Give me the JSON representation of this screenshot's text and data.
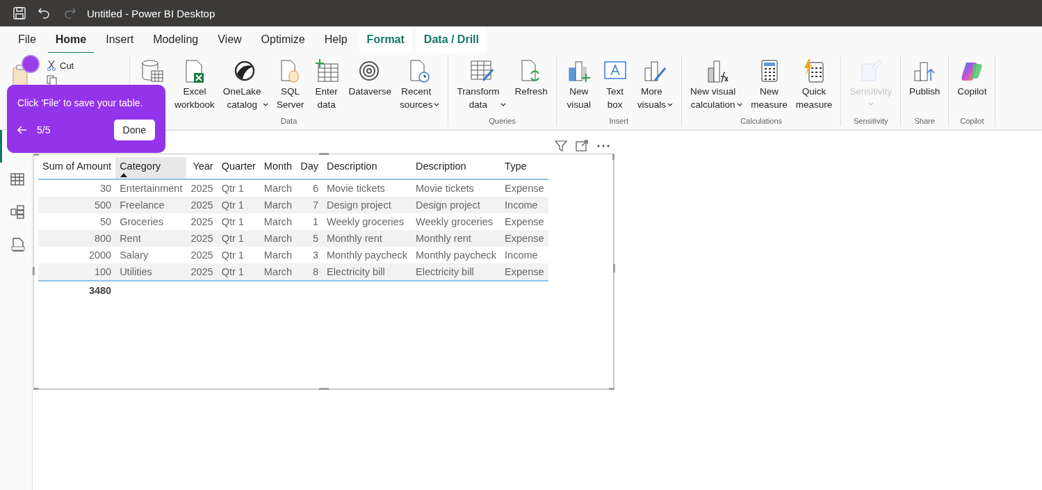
{
  "window": {
    "title": "Untitled - Power BI Desktop"
  },
  "quick_access": [
    {
      "disabled": false
    },
    {
      "disabled": false
    },
    {
      "disabled": true
    }
  ],
  "menu_tabs": [
    {
      "label": "File",
      "selected": false,
      "kind": "normal"
    },
    {
      "label": "Home",
      "selected": true,
      "kind": "normal"
    },
    {
      "label": "Insert",
      "selected": false,
      "kind": "normal"
    },
    {
      "label": "Modeling",
      "selected": false,
      "kind": "normal"
    },
    {
      "label": "View",
      "selected": false,
      "kind": "normal"
    },
    {
      "label": "Optimize",
      "selected": false,
      "kind": "normal"
    },
    {
      "label": "Help",
      "selected": false,
      "kind": "normal"
    },
    {
      "label": "Format",
      "selected": false,
      "kind": "contextual"
    },
    {
      "label": "Data / Drill",
      "selected": false,
      "kind": "contextual"
    }
  ],
  "clipboard": {
    "cut_label": "Cut"
  },
  "ribbon_groups": [
    {
      "label": "Data",
      "buttons": [
        {
          "dropdown": false,
          "disabled": false
        },
        {
          "label": "Excel\nworkbook",
          "dropdown": false,
          "disabled": false
        },
        {
          "label": "OneLake\ncatalog",
          "dropdown": true,
          "disabled": false
        },
        {
          "label": "SQL\nServer",
          "dropdown": false,
          "disabled": false
        },
        {
          "label": "Enter\ndata",
          "dropdown": false,
          "disabled": false
        },
        {
          "label": "Dataverse",
          "dropdown": false,
          "disabled": false
        },
        {
          "label": "Recent\nsources",
          "dropdown": true,
          "disabled": false
        }
      ]
    },
    {
      "label": "Queries",
      "buttons": [
        {
          "label": "Transform\ndata",
          "dropdown": true,
          "disabled": false
        },
        {
          "label": "Refresh",
          "dropdown": false,
          "disabled": false
        }
      ]
    },
    {
      "label": "Insert",
      "buttons": [
        {
          "label": "New\nvisual",
          "dropdown": false,
          "disabled": false
        },
        {
          "label": "Text\nbox",
          "dropdown": false,
          "disabled": false
        },
        {
          "label": "More\nvisuals",
          "dropdown": true,
          "disabled": false
        }
      ]
    },
    {
      "label": "Calculations",
      "buttons": [
        {
          "label": "New visual\ncalculation",
          "dropdown": true,
          "disabled": false
        },
        {
          "label": "New\nmeasure",
          "dropdown": false,
          "disabled": false
        },
        {
          "label": "Quick\nmeasure",
          "dropdown": false,
          "disabled": false
        }
      ]
    },
    {
      "label": "Sensitivity",
      "buttons": [
        {
          "label": "Sensitivity",
          "dropdown": true,
          "disabled": true
        }
      ]
    },
    {
      "label": "Share",
      "buttons": [
        {
          "label": "Publish",
          "dropdown": false,
          "disabled": false
        }
      ]
    },
    {
      "label": "Copilot",
      "buttons": [
        {
          "label": "Copilot",
          "dropdown": false,
          "disabled": false
        }
      ]
    }
  ],
  "side_rail": [
    {
      "selected": true
    },
    {
      "selected": false
    },
    {
      "selected": false
    },
    {
      "selected": false
    }
  ],
  "table": {
    "columns": [
      {
        "label": "Sum of Amount",
        "sorted": false
      },
      {
        "label": "Category",
        "sorted": true
      },
      {
        "label": "Year",
        "sorted": false
      },
      {
        "label": "Quarter",
        "sorted": false
      },
      {
        "label": "Month",
        "sorted": false
      },
      {
        "label": "Day",
        "sorted": false
      },
      {
        "label": "Description",
        "sorted": false
      },
      {
        "label": "Description",
        "sorted": false
      },
      {
        "label": "Type",
        "sorted": false
      }
    ],
    "rows": [
      [
        "30",
        "Entertainment",
        "2025",
        "Qtr 1",
        "March",
        "6",
        "Movie tickets",
        "Movie tickets",
        "Expense"
      ],
      [
        "500",
        "Freelance",
        "2025",
        "Qtr 1",
        "March",
        "7",
        "Design project",
        "Design project",
        "Income"
      ],
      [
        "50",
        "Groceries",
        "2025",
        "Qtr 1",
        "March",
        "1",
        "Weekly groceries",
        "Weekly groceries",
        "Expense"
      ],
      [
        "800",
        "Rent",
        "2025",
        "Qtr 1",
        "March",
        "5",
        "Monthly rent",
        "Monthly rent",
        "Expense"
      ],
      [
        "2000",
        "Salary",
        "2025",
        "Qtr 1",
        "March",
        "3",
        "Monthly paycheck",
        "Monthly paycheck",
        "Income"
      ],
      [
        "100",
        "Utilities",
        "2025",
        "Qtr 1",
        "March",
        "8",
        "Electricity bill",
        "Electricity bill",
        "Expense"
      ]
    ],
    "total": "3480"
  },
  "tour": {
    "text": "Click 'File' to save your table.",
    "step": "5/5",
    "button": "Done"
  }
}
